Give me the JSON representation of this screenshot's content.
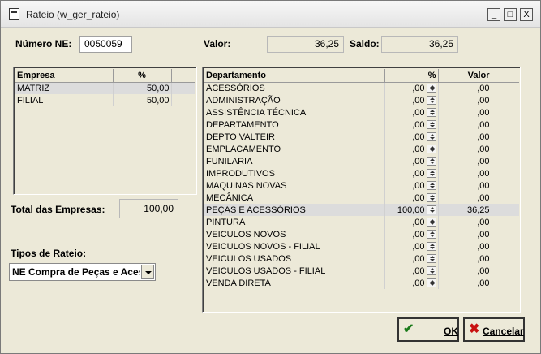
{
  "window": {
    "title": "Rateio (w_ger_rateio)",
    "controls": {
      "minimize": "_",
      "maximize": "□",
      "close": "X"
    }
  },
  "header": {
    "numero_ne_label": "Número NE:",
    "numero_ne_value": "0050059",
    "valor_label": "Valor:",
    "valor_value": "36,25",
    "saldo_label": "Saldo:",
    "saldo_value": "36,25"
  },
  "empresas": {
    "columns": [
      "Empresa",
      "%"
    ],
    "rows": [
      {
        "empresa": "MATRIZ",
        "pct": "50,00"
      },
      {
        "empresa": "FILIAL",
        "pct": "50,00"
      }
    ]
  },
  "total": {
    "label": "Total das Empresas:",
    "value": "100,00"
  },
  "tipos": {
    "label": "Tipos de Rateio:",
    "selected": "NE Compra de Peças e Acessórios"
  },
  "departamentos": {
    "columns": [
      "Departamento",
      "%",
      "Valor"
    ],
    "rows": [
      {
        "nome": "ACESSÓRIOS",
        "pct": ",00",
        "valor": ",00"
      },
      {
        "nome": "ADMINISTRAÇÃO",
        "pct": ",00",
        "valor": ",00"
      },
      {
        "nome": "ASSISTÊNCIA TÉCNICA",
        "pct": ",00",
        "valor": ",00"
      },
      {
        "nome": "DEPARTAMENTO",
        "pct": ",00",
        "valor": ",00"
      },
      {
        "nome": "DEPTO VALTEIR",
        "pct": ",00",
        "valor": ",00"
      },
      {
        "nome": "EMPLACAMENTO",
        "pct": ",00",
        "valor": ",00"
      },
      {
        "nome": "FUNILARIA",
        "pct": ",00",
        "valor": ",00"
      },
      {
        "nome": "IMPRODUTIVOS",
        "pct": ",00",
        "valor": ",00"
      },
      {
        "nome": "MAQUINAS NOVAS",
        "pct": ",00",
        "valor": ",00"
      },
      {
        "nome": "MECÂNICA",
        "pct": ",00",
        "valor": ",00"
      },
      {
        "nome": "PEÇAS E ACESSÓRIOS",
        "pct": "100,00",
        "valor": "36,25"
      },
      {
        "nome": "PINTURA",
        "pct": ",00",
        "valor": ",00"
      },
      {
        "nome": "VEICULOS NOVOS",
        "pct": ",00",
        "valor": ",00"
      },
      {
        "nome": "VEICULOS NOVOS - FILIAL",
        "pct": ",00",
        "valor": ",00"
      },
      {
        "nome": "VEICULOS USADOS",
        "pct": ",00",
        "valor": ",00"
      },
      {
        "nome": "VEICULOS USADOS - FILIAL",
        "pct": ",00",
        "valor": ",00"
      },
      {
        "nome": "VENDA DIRETA",
        "pct": ",00",
        "valor": ",00"
      }
    ]
  },
  "buttons": {
    "ok_label": "OK",
    "cancel_label": "Cancelar"
  },
  "icons": [
    "window-app-icon",
    "check-icon",
    "x-icon",
    "spin-icon",
    "chevron-down-icon"
  ]
}
